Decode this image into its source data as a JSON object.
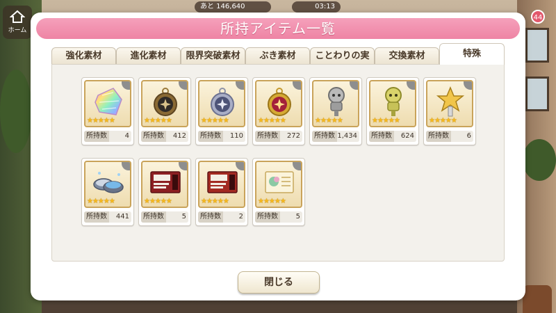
{
  "hud": {
    "home_label": "ホーム",
    "stamina_text": "あと 146,640",
    "time_text": "03:13",
    "notification_count": "44"
  },
  "dialog": {
    "title": "所持アイテム一覧",
    "close_label": "閉じる"
  },
  "tabs": [
    {
      "label": "強化素材",
      "active": false
    },
    {
      "label": "進化素材",
      "active": false
    },
    {
      "label": "限界突破素材",
      "active": false
    },
    {
      "label": "ぶき素材",
      "active": false
    },
    {
      "label": "ことわりの実",
      "active": false
    },
    {
      "label": "交換素材",
      "active": false
    },
    {
      "label": "特殊",
      "active": true
    }
  ],
  "count_label": "所持数",
  "stars": "★★★★★",
  "items": [
    {
      "icon": "rainbow-crystal-icon",
      "count": "4"
    },
    {
      "icon": "bronze-pocket-watch-icon",
      "count": "412"
    },
    {
      "icon": "silver-pocket-watch-icon",
      "count": "110"
    },
    {
      "icon": "red-pocket-watch-icon",
      "count": "272"
    },
    {
      "icon": "silver-idol-key-icon",
      "count": "1,434"
    },
    {
      "icon": "gold-idol-key-icon",
      "count": "624"
    },
    {
      "icon": "golden-star-key-icon",
      "count": "6"
    },
    {
      "icon": "blue-powder-tin-icon",
      "count": "441"
    },
    {
      "icon": "red-ticket-icon",
      "count": "5"
    },
    {
      "icon": "red-ticket-icon",
      "count": "2"
    },
    {
      "icon": "letter-card-icon",
      "count": "5"
    }
  ],
  "colors": {
    "title_pink": "#ee84a4",
    "star_gold": "#f6b81c",
    "frame_gold": "#c9a35a"
  }
}
